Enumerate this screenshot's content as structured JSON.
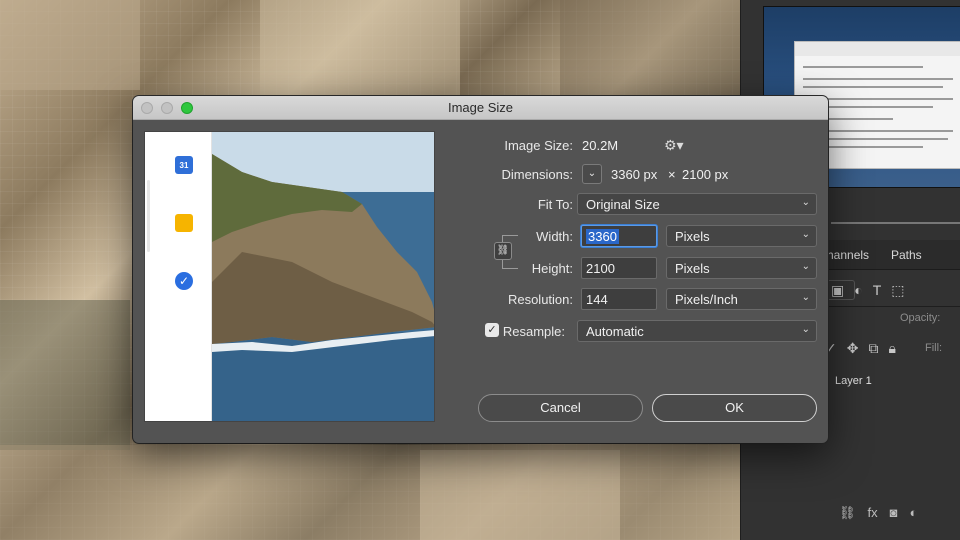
{
  "dialog": {
    "title": "Image Size",
    "image_size_label": "Image Size:",
    "image_size_value": "20.2M",
    "dimensions_label": "Dimensions:",
    "dimensions_width": "3360 px",
    "dimensions_separator": "×",
    "dimensions_height": "2100 px",
    "fit_to_label": "Fit To:",
    "fit_to_value": "Original Size",
    "width_label": "Width:",
    "width_value": "3360",
    "width_unit": "Pixels",
    "height_label": "Height:",
    "height_value": "2100",
    "height_unit": "Pixels",
    "resolution_label": "Resolution:",
    "resolution_value": "144",
    "resolution_unit": "Pixels/Inch",
    "resample_label": "Resample:",
    "resample_checked": true,
    "resample_value": "Automatic",
    "cancel_label": "Cancel",
    "ok_label": "OK"
  },
  "preview": {
    "calendar_badge": "31"
  },
  "photoshop_panel": {
    "tab_channels": "hannels",
    "tab_paths": "Paths",
    "opacity_label": "Opacity:",
    "fill_label": "Fill:",
    "layer_name": "Layer 1"
  },
  "icons": {
    "gear": "gear-icon",
    "link": "link-icon",
    "chevron": "chevron-down-icon",
    "checkmark": "checkmark-icon"
  },
  "colors": {
    "dialog_bg": "#535353",
    "focus_blue": "#2a67c9",
    "zoom_green": "#2ec73e",
    "panel_bg": "#323232"
  }
}
